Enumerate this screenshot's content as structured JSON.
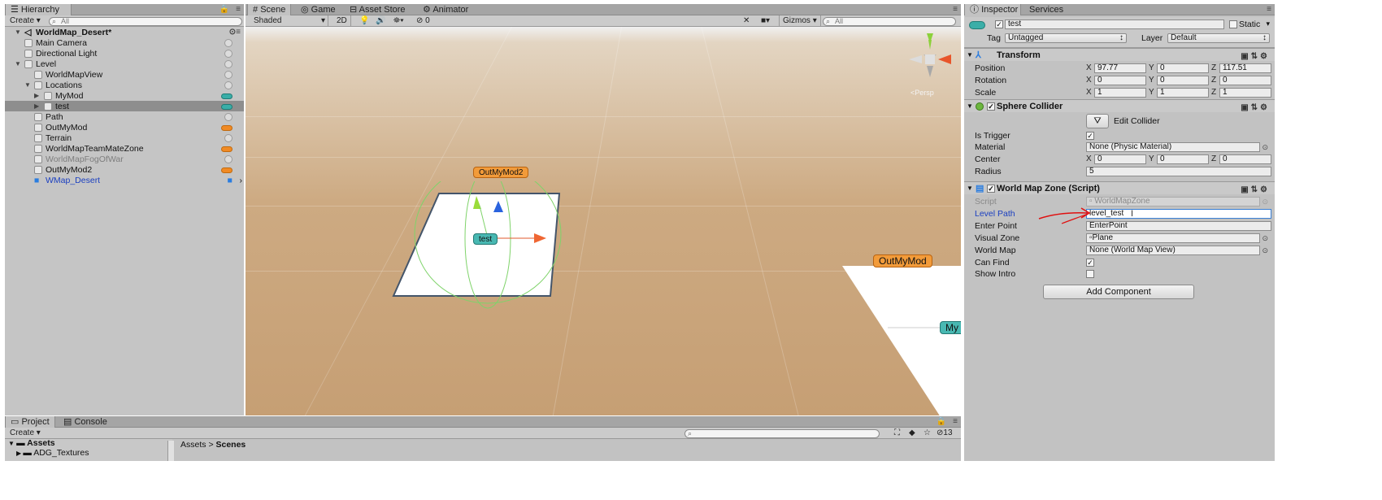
{
  "hierarchy": {
    "tab": "Hierarchy",
    "create": "Create",
    "search_placeholder": "All",
    "scene_name": "WorldMap_Desert*",
    "items": [
      {
        "label": "Main Camera",
        "depth": 1,
        "fold": "",
        "marker": "dot"
      },
      {
        "label": "Directional Light",
        "depth": 1,
        "fold": "",
        "marker": "dot"
      },
      {
        "label": "Level",
        "depth": 1,
        "fold": "open",
        "marker": "dot"
      },
      {
        "label": "WorldMapView",
        "depth": 2,
        "fold": "",
        "marker": "dot"
      },
      {
        "label": "Locations",
        "depth": 2,
        "fold": "open",
        "marker": "dot"
      },
      {
        "label": "MyMod",
        "depth": 3,
        "fold": "closed",
        "marker": "teal"
      },
      {
        "label": "test",
        "depth": 3,
        "fold": "closed",
        "marker": "teal",
        "selected": true
      },
      {
        "label": "Path",
        "depth": 2,
        "fold": "",
        "marker": "dot"
      },
      {
        "label": "OutMyMod",
        "depth": 2,
        "fold": "",
        "marker": "orange"
      },
      {
        "label": "Terrain",
        "depth": 2,
        "fold": "",
        "marker": "dot"
      },
      {
        "label": "WorldMapTeamMateZone",
        "depth": 2,
        "fold": "",
        "marker": "orange"
      },
      {
        "label": "WorldMapFogOfWar",
        "depth": 2,
        "fold": "",
        "marker": "dot",
        "disabled": true
      },
      {
        "label": "OutMyMod2",
        "depth": 2,
        "fold": "",
        "marker": "orange"
      }
    ],
    "prefab_item": "WMap_Desert"
  },
  "scene": {
    "tabs": [
      "Scene",
      "Game",
      "Asset Store",
      "Animator"
    ],
    "shading": "Shaded",
    "mode_2d": "2D",
    "fx_count": "0",
    "gizmos": "Gizmos",
    "search_placeholder": "All",
    "persp_label": "<Persp",
    "labels": {
      "out_my_mod2": "OutMyMod2",
      "test": "test",
      "out_my_mod": "OutMyMod",
      "my_partial": "My"
    }
  },
  "inspector": {
    "tabs": [
      "Inspector",
      "Services"
    ],
    "object_name": "test",
    "static_label": "Static",
    "tag_label": "Tag",
    "tag_value": "Untagged",
    "layer_label": "Layer",
    "layer_value": "Default",
    "transform": {
      "title": "Transform",
      "rows": [
        {
          "label": "Position",
          "x": "97.77",
          "y": "0",
          "z": "117.51"
        },
        {
          "label": "Rotation",
          "x": "0",
          "y": "0",
          "z": "0"
        },
        {
          "label": "Scale",
          "x": "1",
          "y": "1",
          "z": "1"
        }
      ]
    },
    "sphere_collider": {
      "title": "Sphere Collider",
      "edit_collider": "Edit Collider",
      "is_trigger_label": "Is Trigger",
      "material_label": "Material",
      "material_value": "None (Physic Material)",
      "center_label": "Center",
      "center": {
        "x": "0",
        "y": "0",
        "z": "0"
      },
      "radius_label": "Radius",
      "radius_value": "5"
    },
    "world_map_zone": {
      "title": "World Map Zone (Script)",
      "script_label": "Script",
      "script_value": "WorldMapZone",
      "level_path_label": "Level Path",
      "level_path_value": "level_test",
      "enter_point_label": "Enter Point",
      "enter_point_value": "EnterPoint",
      "visual_zone_label": "Visual Zone",
      "visual_zone_value": "Plane",
      "world_map_label": "World Map",
      "world_map_value": "None (World Map View)",
      "can_find_label": "Can Find",
      "show_intro_label": "Show Intro"
    },
    "add_component": "Add Component"
  },
  "project": {
    "tabs": [
      "Project",
      "Console"
    ],
    "create": "Create",
    "tree_root": "Assets",
    "tree_item": "ADG_Textures",
    "breadcrumb_root": "Assets",
    "breadcrumb_sep": ">",
    "breadcrumb_current": "Scenes",
    "hidden_count": "13"
  },
  "colors": {
    "orange_marker": "#f08a24",
    "teal_marker": "#3aaea8",
    "annotation_red": "#e01010",
    "link_blue": "#1a3fc0"
  }
}
